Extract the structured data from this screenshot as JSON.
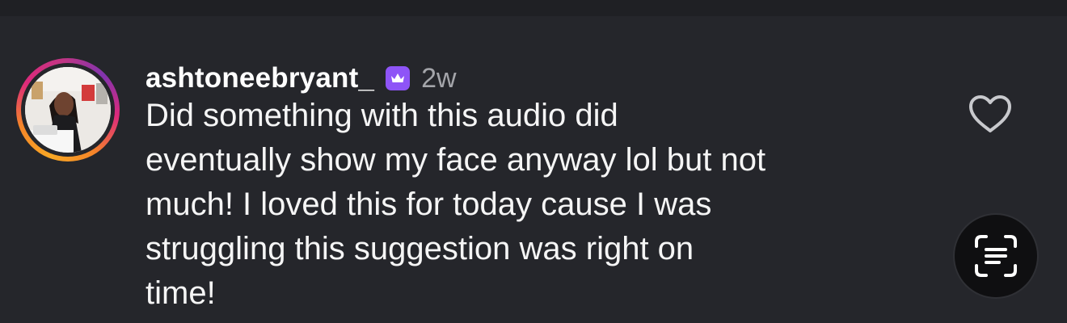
{
  "comment": {
    "username": "ashtoneebryant_",
    "time_ago": "2w",
    "text": "Did something with this audio did\neventually show my face anyway lol but not\nmuch! I loved this for today cause I was\nstruggling this suggestion was right on\ntime!"
  },
  "icons": {
    "badge": "crown-icon",
    "like": "heart-icon",
    "scan": "live-text-scan-icon"
  },
  "colors": {
    "background": "#25262b",
    "badge": "#8e54f7",
    "timestamp": "#a4a5aa",
    "story_ring_start": "#f9a825",
    "story_ring_end": "#dd2a7b"
  }
}
